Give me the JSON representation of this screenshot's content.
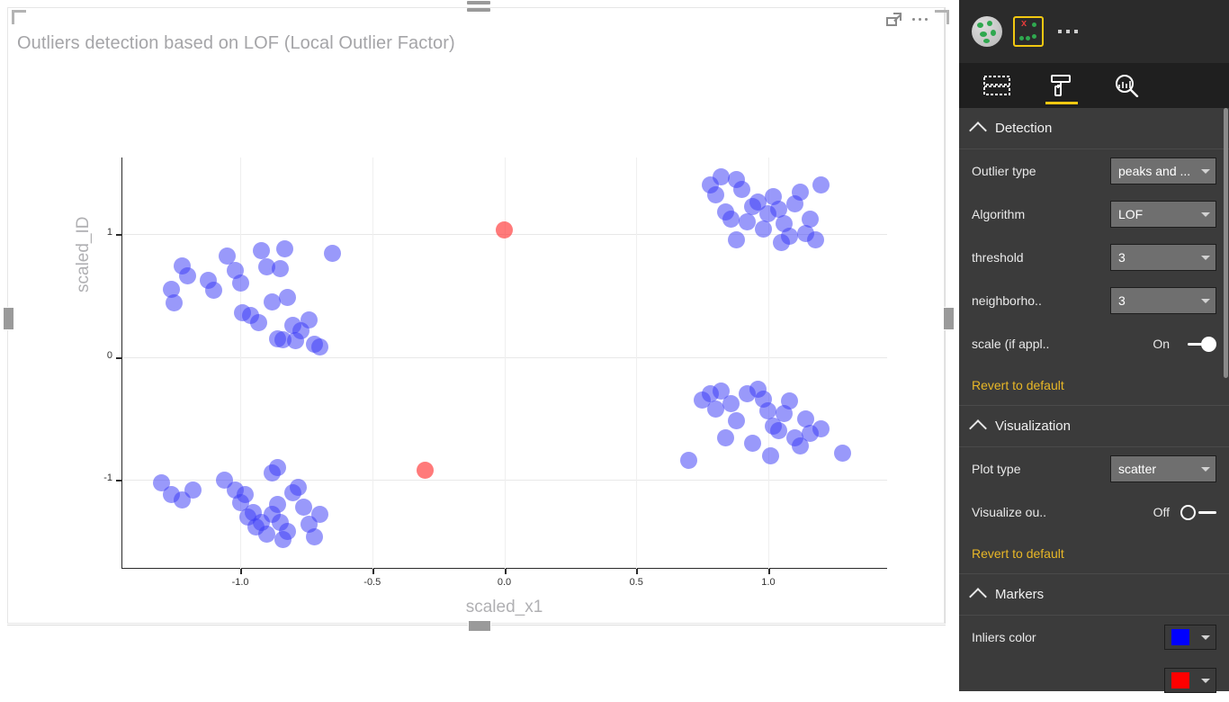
{
  "visual": {
    "title": "Outliers detection based on LOF (Local Outlier Factor)",
    "focus_icon": "focus-mode-icon",
    "more_icon": "more-options-icon"
  },
  "chart_data": {
    "type": "scatter",
    "title": "Outliers detection based on LOF (Local Outlier Factor)",
    "xlabel": "scaled_x1",
    "ylabel": "scaled_ID",
    "xlim": [
      -1.45,
      1.45
    ],
    "ylim": [
      -1.72,
      1.62
    ],
    "xticks": [
      -1.0,
      -0.5,
      0.0,
      0.5,
      1.0
    ],
    "xticklabels": [
      "-1.0",
      "-0.5",
      "0.0",
      "0.5",
      "1.0"
    ],
    "yticks": [
      1,
      0,
      -1
    ],
    "yticklabels": [
      "1",
      "0",
      "-1"
    ],
    "grid": "horizontal-and-vertical-light",
    "legend": "none",
    "series": [
      {
        "name": "inliers",
        "color": "#3c3cf5",
        "marker": "circle",
        "opacity": 0.52,
        "points": [
          [
            -1.22,
            0.74
          ],
          [
            -1.2,
            0.66
          ],
          [
            -1.26,
            0.55
          ],
          [
            -1.25,
            0.44
          ],
          [
            -1.12,
            0.62
          ],
          [
            -1.1,
            0.54
          ],
          [
            -1.05,
            0.82
          ],
          [
            -1.02,
            0.7
          ],
          [
            -1.0,
            0.6
          ],
          [
            -0.99,
            0.36
          ],
          [
            -0.96,
            0.34
          ],
          [
            -0.93,
            0.28
          ],
          [
            -0.92,
            0.86
          ],
          [
            -0.9,
            0.73
          ],
          [
            -0.88,
            0.45
          ],
          [
            -0.86,
            0.15
          ],
          [
            -0.84,
            0.14
          ],
          [
            -0.82,
            0.48
          ],
          [
            -0.8,
            0.26
          ],
          [
            -0.79,
            0.13
          ],
          [
            -0.77,
            0.21
          ],
          [
            -0.74,
            0.3
          ],
          [
            -0.72,
            0.1
          ],
          [
            -0.7,
            0.08
          ],
          [
            -0.83,
            0.88
          ],
          [
            -0.85,
            0.72
          ],
          [
            -0.65,
            0.84
          ],
          [
            -1.3,
            -1.02
          ],
          [
            -1.26,
            -1.12
          ],
          [
            -1.22,
            -1.16
          ],
          [
            -1.18,
            -1.08
          ],
          [
            -1.06,
            -1.0
          ],
          [
            -1.02,
            -1.08
          ],
          [
            -1.0,
            -1.18
          ],
          [
            -0.98,
            -1.12
          ],
          [
            -0.97,
            -1.3
          ],
          [
            -0.95,
            -1.26
          ],
          [
            -0.94,
            -1.38
          ],
          [
            -0.92,
            -1.34
          ],
          [
            -0.9,
            -1.44
          ],
          [
            -0.88,
            -1.28
          ],
          [
            -0.86,
            -1.2
          ],
          [
            -0.85,
            -1.34
          ],
          [
            -0.84,
            -1.48
          ],
          [
            -0.82,
            -1.42
          ],
          [
            -0.8,
            -1.1
          ],
          [
            -0.78,
            -1.06
          ],
          [
            -0.76,
            -1.22
          ],
          [
            -0.74,
            -1.36
          ],
          [
            -0.72,
            -1.46
          ],
          [
            -0.88,
            -0.94
          ],
          [
            -0.86,
            -0.9
          ],
          [
            -0.7,
            -1.28
          ],
          [
            0.78,
            1.4
          ],
          [
            0.8,
            1.32
          ],
          [
            0.82,
            1.46
          ],
          [
            0.84,
            1.18
          ],
          [
            0.86,
            1.12
          ],
          [
            0.88,
            1.44
          ],
          [
            0.9,
            1.36
          ],
          [
            0.92,
            1.1
          ],
          [
            0.94,
            1.22
          ],
          [
            0.96,
            1.26
          ],
          [
            0.98,
            1.04
          ],
          [
            1.0,
            1.16
          ],
          [
            1.02,
            1.3
          ],
          [
            1.04,
            1.2
          ],
          [
            1.06,
            1.08
          ],
          [
            1.08,
            0.98
          ],
          [
            1.1,
            1.24
          ],
          [
            1.12,
            1.34
          ],
          [
            1.14,
            1.0
          ],
          [
            1.16,
            1.12
          ],
          [
            1.18,
            0.95
          ],
          [
            1.2,
            1.4
          ],
          [
            0.88,
            0.95
          ],
          [
            1.05,
            0.93
          ],
          [
            0.75,
            -0.35
          ],
          [
            0.78,
            -0.3
          ],
          [
            0.8,
            -0.42
          ],
          [
            0.82,
            -0.28
          ],
          [
            0.86,
            -0.38
          ],
          [
            0.88,
            -0.52
          ],
          [
            0.92,
            -0.3
          ],
          [
            0.96,
            -0.26
          ],
          [
            0.98,
            -0.34
          ],
          [
            1.0,
            -0.44
          ],
          [
            1.02,
            -0.56
          ],
          [
            1.04,
            -0.6
          ],
          [
            1.06,
            -0.46
          ],
          [
            1.08,
            -0.36
          ],
          [
            1.1,
            -0.66
          ],
          [
            1.12,
            -0.72
          ],
          [
            1.14,
            -0.5
          ],
          [
            1.16,
            -0.62
          ],
          [
            1.2,
            -0.58
          ],
          [
            1.28,
            -0.78
          ],
          [
            0.7,
            -0.84
          ],
          [
            0.94,
            -0.7
          ],
          [
            1.01,
            -0.8
          ],
          [
            0.84,
            -0.66
          ]
        ]
      },
      {
        "name": "outliers",
        "color": "#ff2828",
        "marker": "circle",
        "opacity": 0.62,
        "points": [
          [
            0.0,
            1.03
          ],
          [
            -0.3,
            -0.92
          ]
        ]
      }
    ]
  },
  "pane": {
    "visual_icons": [
      {
        "name": "globe-visual-icon",
        "selected": false
      },
      {
        "name": "outlier-detection-visual-icon",
        "selected": true
      }
    ],
    "more_icon": "more-visuals-icon",
    "tabs": [
      {
        "name": "fields-tab",
        "icon": "fields-table-icon",
        "active": false
      },
      {
        "name": "format-tab",
        "icon": "paint-roller-icon",
        "active": true
      },
      {
        "name": "analytics-tab",
        "icon": "analytics-magnifier-icon",
        "active": false
      }
    ],
    "sections": [
      {
        "name": "detection",
        "title": "Detection",
        "rows": [
          {
            "name": "outlier-type",
            "label": "Outlier type",
            "control": "dropdown",
            "value": "peaks and ..."
          },
          {
            "name": "algorithm",
            "label": "Algorithm",
            "control": "dropdown",
            "value": "LOF"
          },
          {
            "name": "threshold",
            "label": "threshold",
            "control": "dropdown",
            "value": "3"
          },
          {
            "name": "neighborhood",
            "label": "neighborho..",
            "control": "dropdown",
            "value": "3"
          },
          {
            "name": "scale-if-applicable",
            "label": "scale (if appl..",
            "control": "toggle",
            "value": "On"
          }
        ],
        "revert": "Revert to default"
      },
      {
        "name": "visualization",
        "title": "Visualization",
        "rows": [
          {
            "name": "plot-type",
            "label": "Plot type",
            "control": "dropdown",
            "value": "scatter"
          },
          {
            "name": "visualize-outliers",
            "label": "Visualize ou..",
            "control": "toggle",
            "value": "Off"
          }
        ],
        "revert": "Revert to default"
      },
      {
        "name": "markers",
        "title": "Markers",
        "rows": [
          {
            "name": "inliers-color",
            "label": "Inliers color",
            "control": "swatch",
            "value": "#0000ff"
          },
          {
            "name": "outliers-color",
            "label": "",
            "control": "swatch",
            "value": "#ff0000"
          }
        ],
        "revert": ""
      }
    ]
  }
}
